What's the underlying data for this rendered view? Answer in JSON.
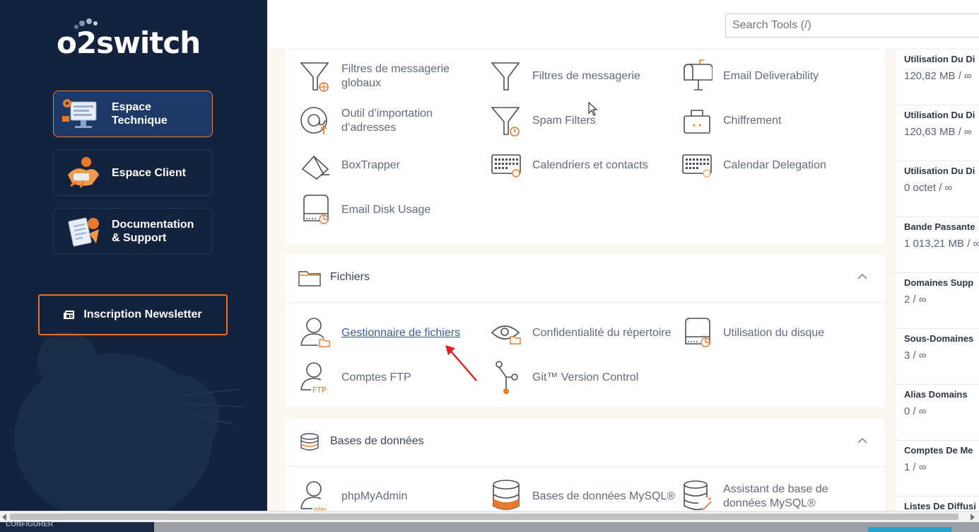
{
  "brand": {
    "logo_text": "o2switch"
  },
  "sidebar": {
    "items": [
      {
        "label": "Espace\nTechnique",
        "active": true
      },
      {
        "label": "Espace Client",
        "active": false
      },
      {
        "label": "Documentation\n& Support",
        "active": false
      }
    ],
    "newsletter_label": "Inscription Newsletter"
  },
  "header": {
    "search_placeholder": "Search Tools (/)"
  },
  "email_section": {
    "tools": [
      {
        "label": "Filtres de messagerie globaux",
        "icon": "funnel-globe-icon"
      },
      {
        "label": "Filtres de messagerie",
        "icon": "funnel-icon"
      },
      {
        "label": "Email Deliverability",
        "icon": "mailbox-icon"
      },
      {
        "label": "Outil d’importation d’adresses",
        "icon": "at-import-icon"
      },
      {
        "label": "Spam Filters",
        "icon": "funnel-clock-icon"
      },
      {
        "label": "Chiffrement",
        "icon": "lock-icon"
      },
      {
        "label": "BoxTrapper",
        "icon": "box-trap-icon"
      },
      {
        "label": "Calendriers et contacts",
        "icon": "calendar-icon"
      },
      {
        "label": "Calendar Delegation",
        "icon": "calendar-gear-icon"
      },
      {
        "label": "Email Disk Usage",
        "icon": "disk-pie-icon"
      }
    ]
  },
  "files_section": {
    "title": "Fichiers",
    "tools": [
      {
        "label": "Gestionnaire de fichiers",
        "icon": "user-folder-icon"
      },
      {
        "label": "Confidentialité du répertoire",
        "icon": "eye-folder-icon"
      },
      {
        "label": "Utilisation du disque",
        "icon": "disk-pie-icon"
      },
      {
        "label": "Comptes FTP",
        "icon": "user-ftp-icon"
      },
      {
        "label": "Git™ Version Control",
        "icon": "git-branch-icon"
      }
    ]
  },
  "db_section": {
    "title": "Bases de données",
    "tools": [
      {
        "label": "phpMyAdmin",
        "icon": "user-php-icon"
      },
      {
        "label": "Bases de données MySQL®",
        "icon": "database-icon"
      },
      {
        "label": "Assistant de base de données MySQL®",
        "icon": "database-wand-icon"
      }
    ]
  },
  "stats": [
    {
      "label": "Utilisation Du Di",
      "value": "120,82 MB / ∞"
    },
    {
      "label": "Utilisation Du Di",
      "value": "120,63 MB / ∞"
    },
    {
      "label": "Utilisation Du Di",
      "value": "0 octet / ∞"
    },
    {
      "label": "Bande Passante",
      "value": "1 013,21 MB / ∞"
    },
    {
      "label": "Domaines Supp",
      "value": "2 / ∞"
    },
    {
      "label": "Sous-Domaines",
      "value": "3 / ∞"
    },
    {
      "label": "Alias Domains",
      "value": "0 / ∞"
    },
    {
      "label": "Comptes De Me",
      "value": "1 / ∞"
    },
    {
      "label": "Listes De Diffusi",
      "value": ""
    }
  ],
  "taskbar": {
    "left_label": "CONFIGURER"
  },
  "colors": {
    "sidebar_bg": "#13233d",
    "accent": "#e87a2a",
    "link": "#3a5f9a"
  }
}
